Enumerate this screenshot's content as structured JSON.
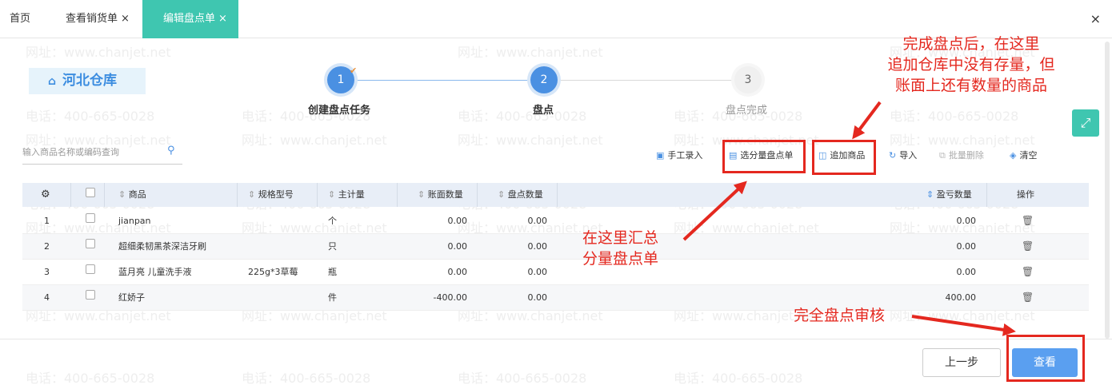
{
  "tabs": [
    {
      "label": "首页",
      "closable": false,
      "active": false
    },
    {
      "label": "查看销货单",
      "closable": true,
      "active": false
    },
    {
      "label": "编辑盘点单",
      "closable": true,
      "active": true
    }
  ],
  "close_glyph": "×",
  "warehouse": {
    "name": "河北仓库",
    "icon": "warehouse-icon"
  },
  "steps": [
    {
      "number": "1",
      "label": "创建盘点任务",
      "state": "done"
    },
    {
      "number": "2",
      "label": "盘点",
      "state": "current"
    },
    {
      "number": "3",
      "label": "盘点完成",
      "state": "pending"
    }
  ],
  "search": {
    "placeholder": "输入商品名称或编码查询",
    "icon": "search-icon"
  },
  "toolbar": {
    "manual_entry": "手工录入",
    "select_sub": "选分量盘点单",
    "add_goods": "追加商品",
    "import": "导入",
    "batch_delete": "批量删除",
    "clear": "清空"
  },
  "table": {
    "headers": {
      "goods": "商品",
      "spec": "规格型号",
      "unit": "主计量",
      "book_qty": "账面数量",
      "count_qty": "盘点数量",
      "diff_qty": "盈亏数量",
      "action": "操作"
    },
    "rows": [
      {
        "no": "1",
        "goods": "jianpan",
        "spec": "",
        "unit": "个",
        "book_qty": "0.00",
        "count_qty": "0.00",
        "diff_qty": "0.00"
      },
      {
        "no": "2",
        "goods": "超细柔韧黑茶深洁牙刷",
        "spec": "",
        "unit": "只",
        "book_qty": "0.00",
        "count_qty": "0.00",
        "diff_qty": "0.00"
      },
      {
        "no": "3",
        "goods": "蓝月亮 儿童洗手液",
        "spec": "225g*3草莓",
        "unit": "瓶",
        "book_qty": "0.00",
        "count_qty": "0.00",
        "diff_qty": "0.00"
      },
      {
        "no": "4",
        "goods": "红娇子",
        "spec": "",
        "unit": "件",
        "book_qty": "-400.00",
        "count_qty": "0.00",
        "diff_qty": "400.00"
      }
    ]
  },
  "footer": {
    "prev": "上一步",
    "view": "查看"
  },
  "annotations": {
    "top_right": [
      "完成盘点后，在这里",
      "追加仓库中没有存量，但",
      "账面上还有数量的商品"
    ],
    "middle": [
      "在这里汇总",
      "分量盘点单"
    ],
    "bottom": "完全盘点审核"
  },
  "watermark": {
    "phone": "电话：400-665-0028",
    "site": "网址：www.chanjet.net"
  },
  "colors": {
    "accent": "#3fc6b0",
    "primary": "#4a90e2",
    "annotation": "#e4281f"
  }
}
